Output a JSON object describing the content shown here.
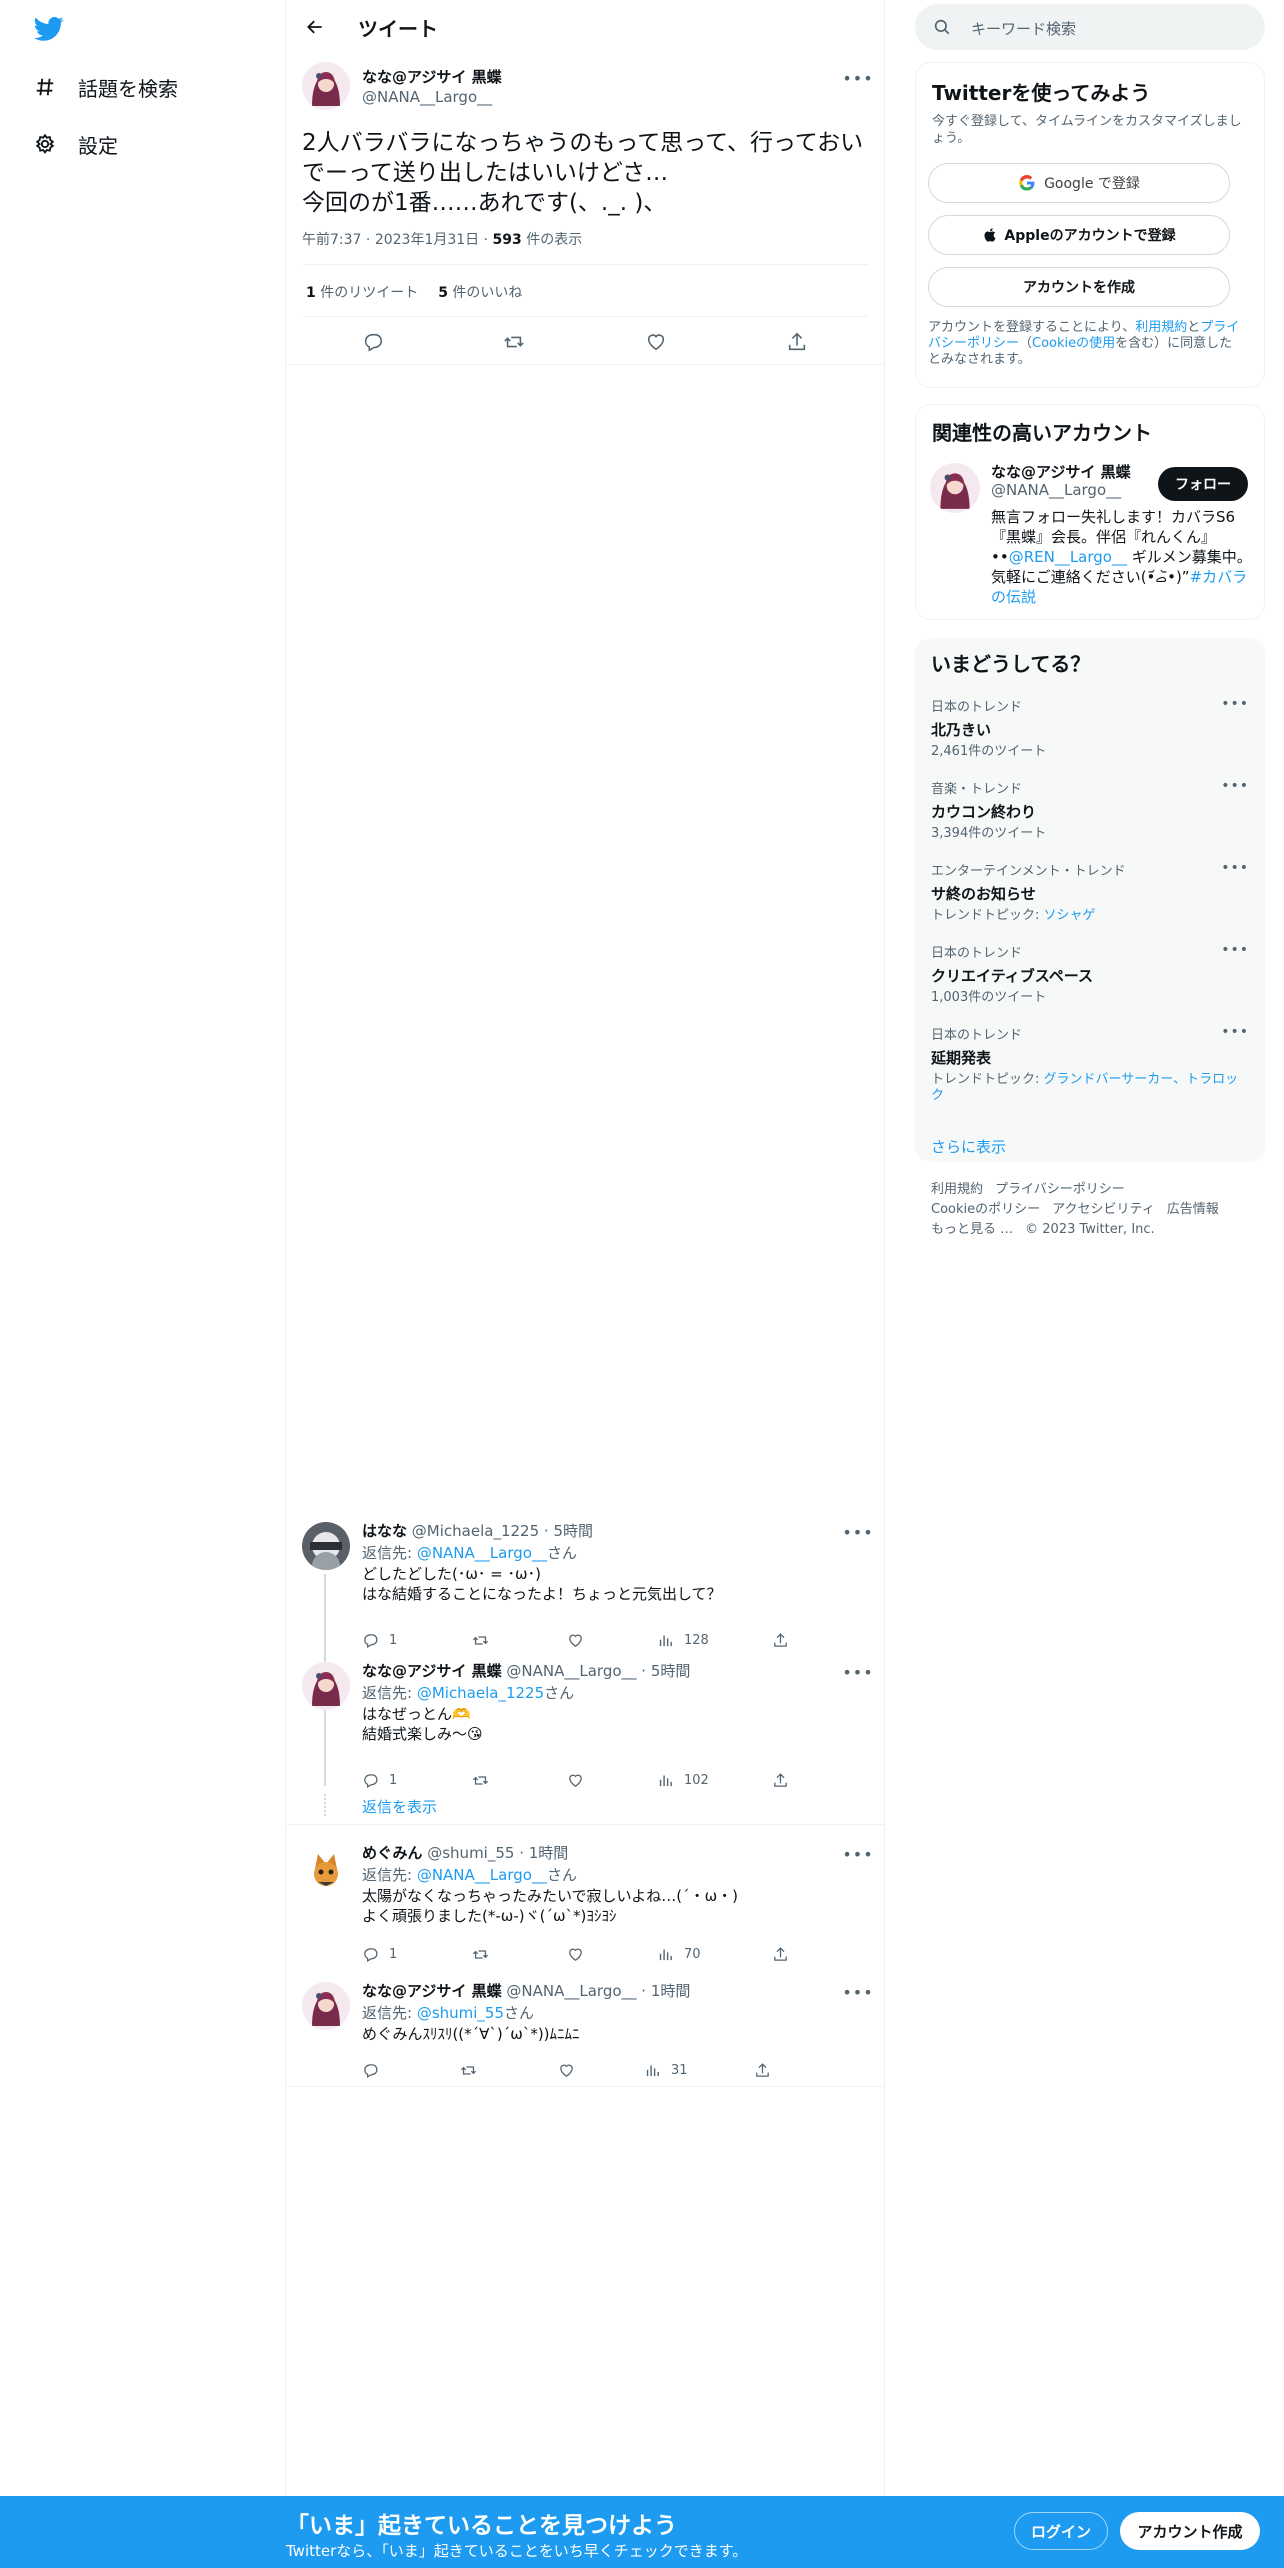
{
  "nav": {
    "items": [
      {
        "label": "話題を検索",
        "icon": "hashtag-icon"
      },
      {
        "label": "設定",
        "icon": "gear-icon"
      }
    ]
  },
  "header": {
    "title": "ツイート"
  },
  "tweet": {
    "name": "なな@アジサイ 黒蝶",
    "handle": "@NANA__Largo__",
    "text": "2人バラバラになっちゃうのもって思って、行っておいでーって送り出したはいいけどさ…\n今回のが1番……あれです(、._. )、",
    "time": "午前7:37",
    "date": "2023年1月31日",
    "views_count": "593",
    "views_label": " 件の表示",
    "retweets_count": "1",
    "retweets_label": " 件のリツイート",
    "likes_count": "5",
    "likes_label": " 件のいいね"
  },
  "replies": [
    {
      "name": "はなな",
      "handle": "@Michaela_1225",
      "time": "5時間",
      "replyto_prefix": "返信先: ",
      "replyto_handle": "@NANA__Largo__",
      "replyto_suffix": "さん",
      "text": "どしたどした(･ω･ = ･ω･)\nはな結婚することになったよ！ちょっと元気出して？",
      "replies": "1",
      "retweets": "",
      "likes": "",
      "views": "128"
    },
    {
      "name": "なな@アジサイ 黒蝶",
      "handle": "@NANA__Largo__",
      "time": "5時間",
      "replyto_prefix": "返信先: ",
      "replyto_handle": "@Michaela_1225",
      "replyto_suffix": "さん",
      "text": "はなぜっとん🫶\n結婚式楽しみ〜😘",
      "replies": "1",
      "retweets": "",
      "likes": "",
      "views": "102"
    },
    {
      "name": "めぐみん",
      "handle": "@shumi_55",
      "time": "1時間",
      "replyto_prefix": "返信先: ",
      "replyto_handle": "@NANA__Largo__",
      "replyto_suffix": "さん",
      "text": "太陽がなくなっちゃったみたいで寂しいよね…(´・ω・)\nよく頑張りました(*-ω-)ヾ(´ω`*)ﾖｼﾖｼ",
      "replies": "1",
      "retweets": "",
      "likes": "",
      "views": "70"
    },
    {
      "name": "なな@アジサイ 黒蝶",
      "handle": "@NANA__Largo__",
      "time": "1時間",
      "replyto_prefix": "返信先: ",
      "replyto_handle": "@shumi_55",
      "replyto_suffix": "さん",
      "text": "めぐみんｽﾘｽﾘ((*´∀`)´ω`*))ﾑﾆﾑﾆ",
      "replies": "",
      "retweets": "",
      "likes": "",
      "views": "31"
    }
  ],
  "show_replies": "返信を表示",
  "search": {
    "placeholder": "キーワード検索"
  },
  "signup": {
    "title": "Twitterを使ってみよう",
    "subtitle": "今すぐ登録して、タイムラインをカスタマイズしましょう。",
    "google": "Google で登録",
    "apple": "Appleのアカウントで登録",
    "create": "アカウントを作成",
    "legal_1": "アカウントを登録することにより、",
    "legal_terms": "利用規約",
    "legal_2": "と",
    "legal_privacy": "プライバシーポリシー",
    "legal_3": "（",
    "legal_cookie": "Cookieの使用",
    "legal_4": "を含む）に同意したとみなされます。"
  },
  "related": {
    "title": "関連性の高いアカウント",
    "name": "なな@アジサイ 黒蝶",
    "handle": "@NANA__Largo__",
    "follow": "フォロー",
    "bio_1": "無言フォロー失礼します！カバラS6『黒蝶』会長。伴侶『れんくん』••",
    "bio_mention": "@REN__Largo__",
    "bio_2": " ギルメン募集中。気軽にご連絡ください(•᷄ࡇ•᷅)”",
    "bio_tag": "#カバラの伝説"
  },
  "trends": {
    "title": "いまどうしてる？",
    "items": [
      {
        "context": "日本のトレンド",
        "title": "北乃きい",
        "sub": "2,461件のツイート",
        "sub_link": ""
      },
      {
        "context": "音楽・トレンド",
        "title": "カウコン終わり",
        "sub": "3,394件のツイート",
        "sub_link": ""
      },
      {
        "context": "エンターテインメント・トレンド",
        "title": "サ終のお知らせ",
        "sub": "トレンドトピック: ",
        "sub_link": "ソシャゲ"
      },
      {
        "context": "日本のトレンド",
        "title": "クリエイティブスペース",
        "sub": "1,003件のツイート",
        "sub_link": ""
      },
      {
        "context": "日本のトレンド",
        "title": "延期発表",
        "sub": "トレンドトピック: ",
        "sub_link": "グランドバーサーカー、トラロック"
      }
    ],
    "show_more": "さらに表示"
  },
  "footer": {
    "terms": "利用規約",
    "privacy": "プライバシーポリシー",
    "cookie": "Cookieのポリシー",
    "accessibility": "アクセシビリティ",
    "ads": "広告情報",
    "more": "もっと見る …",
    "copyright": "© 2023 Twitter, Inc."
  },
  "bottom": {
    "title": "「いま」起きていることを見つけよう",
    "subtitle": "Twitterなら、「いま」起きていることをいち早くチェックできます。",
    "login": "ログイン",
    "signup": "アカウント作成"
  },
  "colors": {
    "accent": "#1d9bf0",
    "text": "#0f1419",
    "muted": "#536471",
    "border": "#eff3f4"
  }
}
